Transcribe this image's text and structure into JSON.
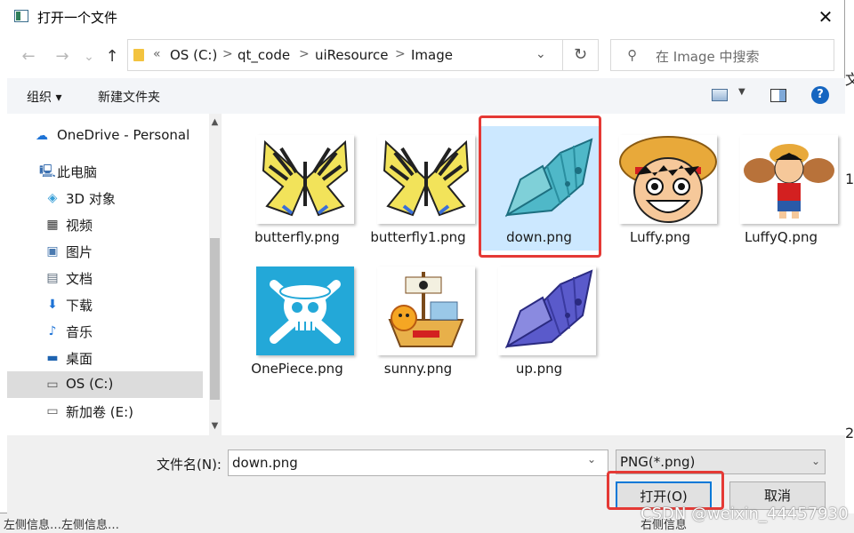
{
  "window": {
    "title": "打开一个文件",
    "close_glyph": "✕"
  },
  "address": {
    "back_glyph": "←",
    "forward_glyph": "→",
    "recent_glyph": "⌄",
    "up_glyph": "↑",
    "prefix": "«",
    "sep": ">",
    "crumbs": [
      "OS (C:)",
      "qt_code",
      "uiResource",
      "Image"
    ],
    "dropdown_glyph": "⌄",
    "refresh_glyph": "↻"
  },
  "search": {
    "placeholder": "在 Image 中搜索",
    "icon_glyph": "⚲"
  },
  "toolbar": {
    "organize": "组织 ▾",
    "new_folder": "新建文件夹",
    "help": "?",
    "view_caret": "▼"
  },
  "sidebar": {
    "items": [
      {
        "label": "OneDrive - Personal",
        "icon": "onedrive-icon",
        "glyph": "☁",
        "color": "#1e73d6"
      },
      {
        "label": "此电脑",
        "icon": "computer-icon",
        "glyph": "🖳",
        "color": "#3a6fb0"
      },
      {
        "label": "3D 对象",
        "icon": "3d-objects-icon",
        "glyph": "◈",
        "color": "#3aa0d8"
      },
      {
        "label": "视频",
        "icon": "video-icon",
        "glyph": "▦",
        "color": "#333333"
      },
      {
        "label": "图片",
        "icon": "pictures-icon",
        "glyph": "▣",
        "color": "#4a7ab0"
      },
      {
        "label": "文档",
        "icon": "documents-icon",
        "glyph": "▤",
        "color": "#5a6a7a"
      },
      {
        "label": "下载",
        "icon": "downloads-icon",
        "glyph": "⬇",
        "color": "#1e73d6"
      },
      {
        "label": "音乐",
        "icon": "music-icon",
        "glyph": "♪",
        "color": "#1e73d6"
      },
      {
        "label": "桌面",
        "icon": "desktop-icon",
        "glyph": "▬",
        "color": "#1e63b0"
      },
      {
        "label": "OS (C:)",
        "icon": "drive-c-icon",
        "glyph": "▭",
        "color": "#555555"
      },
      {
        "label": "新加卷 (E:)",
        "icon": "drive-e-icon",
        "glyph": "▭",
        "color": "#555555"
      }
    ],
    "scroll_up": "▲",
    "scroll_down": "▼"
  },
  "files": [
    {
      "name": "butterfly.png",
      "kind": "butterfly-yellow"
    },
    {
      "name": "butterfly1.png",
      "kind": "butterfly-yellow"
    },
    {
      "name": "down.png",
      "kind": "butterfly-teal"
    },
    {
      "name": "Luffy.png",
      "kind": "luffy"
    },
    {
      "name": "LuffyQ.png",
      "kind": "luffyq"
    },
    {
      "name": "OnePiece.png",
      "kind": "onepiece"
    },
    {
      "name": "sunny.png",
      "kind": "sunny"
    },
    {
      "name": "up.png",
      "kind": "butterfly-blue"
    }
  ],
  "selected_file": "down.png",
  "bottom": {
    "filename_label": "文件名(N):",
    "filename_value": "down.png",
    "filetype_value": "PNG(*.png)",
    "open_button": "打开(O)",
    "cancel_button": "取消",
    "caret": "⌄"
  },
  "background": {
    "right_chars": [
      "文",
      "1",
      "2"
    ],
    "bottom_left": "左侧信息…左侧信息…",
    "bottom_right": "右侧信息",
    "watermark": "CSDN @weixin_44457930"
  },
  "colors": {
    "highlight": "#e53935",
    "selection": "#cce8ff",
    "accent": "#0078d7"
  }
}
